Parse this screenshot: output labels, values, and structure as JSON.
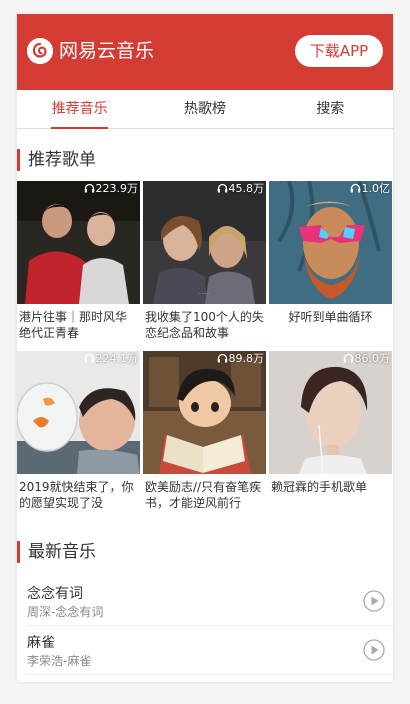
{
  "header": {
    "app_title": "网易云音乐",
    "download_label": "下载APP"
  },
  "tabs": [
    {
      "label": "推荐音乐",
      "active": true
    },
    {
      "label": "热歌榜",
      "active": false
    },
    {
      "label": "搜索",
      "active": false
    }
  ],
  "recommended": {
    "title": "推荐歌单",
    "playlists": [
      {
        "count": "223.9万",
        "name": "港片往事｜那时风华绝代正青春"
      },
      {
        "count": "45.8万",
        "name": "我收集了100个人的失恋纪念品和故事"
      },
      {
        "count": "1.0亿",
        "name": "好听到单曲循环"
      },
      {
        "count": "224.1万",
        "name": "2019就快结束了，你的愿望实现了没"
      },
      {
        "count": "89.8万",
        "name": "欧美励志//只有奋笔疾书，才能逆风前行"
      },
      {
        "count": "86.0万",
        "name": "赖冠霖的手机歌单"
      }
    ]
  },
  "latest": {
    "title": "最新音乐",
    "songs": [
      {
        "title": "念念有词",
        "artist": "周深-念念有词"
      },
      {
        "title": "麻雀",
        "artist": "李荣浩-麻雀"
      }
    ]
  },
  "colors": {
    "brand": "#d43c33"
  }
}
